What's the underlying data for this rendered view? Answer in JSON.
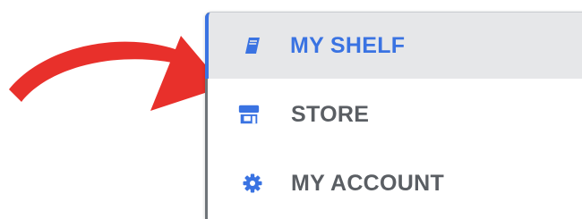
{
  "menu": {
    "items": [
      {
        "label": "MY SHELF",
        "icon": "book-icon",
        "active": true
      },
      {
        "label": "STORE",
        "icon": "store-icon",
        "active": false
      },
      {
        "label": "MY ACCOUNT",
        "icon": "gear-icon",
        "active": false
      }
    ]
  },
  "colors": {
    "accent": "#3a73e2",
    "arrow": "#e8302b",
    "active_background": "#e6e7e9",
    "text_gray": "#5a5e63"
  }
}
